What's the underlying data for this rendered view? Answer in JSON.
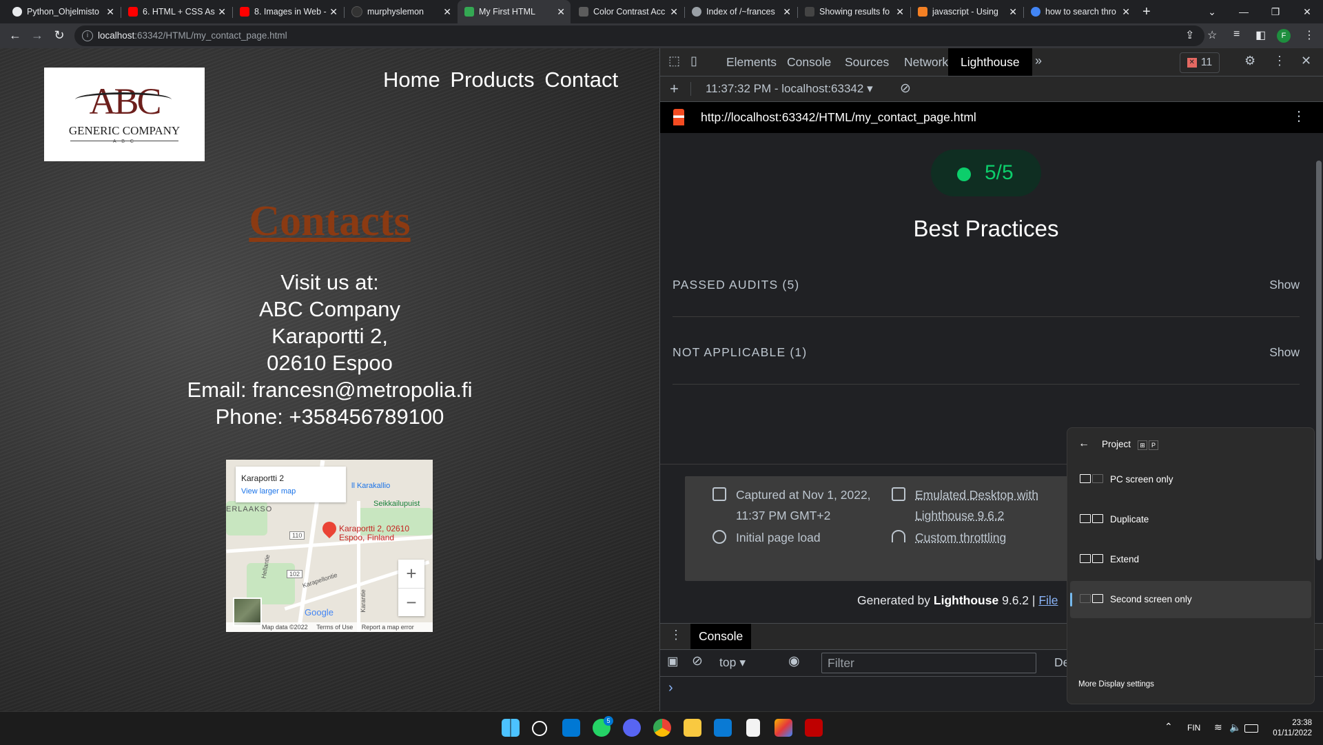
{
  "browser": {
    "tabs": [
      {
        "title": "Python_Ohjelmisto",
        "color": "#e8eaed"
      },
      {
        "title": "6. HTML + CSS Ass",
        "color": "#ff0000"
      },
      {
        "title": "8. Images in Web -",
        "color": "#ff0000"
      },
      {
        "title": "murphyslemon",
        "color": "#333333"
      },
      {
        "title": "My First HTML",
        "color": "#34a853"
      },
      {
        "title": "Color Contrast Acc",
        "color": "#5c5c5c"
      },
      {
        "title": "Index of /~frances",
        "color": "#9aa0a6"
      },
      {
        "title": "Showing results fo",
        "color": "#444444"
      },
      {
        "title": "javascript - Using",
        "color": "#f48024"
      },
      {
        "title": "how to search thro",
        "color": "#4285f4"
      }
    ],
    "url_host": "localhost",
    "url_rest": ":63342/HTML/my_contact_page.html",
    "profile_initial": "F"
  },
  "page": {
    "logo": {
      "abc": "ABC",
      "company": "GENERIC COMPANY",
      "small": "A B C"
    },
    "nav": [
      "Home",
      "Products",
      "Contact"
    ],
    "heading": "Contacts",
    "address": [
      "Visit us at:",
      "ABC Company",
      "Karaportti 2,",
      "02610 Espoo",
      "Email: francesn@metropolia.fi",
      "Phone: +358456789100"
    ],
    "map": {
      "place": "Karaportti 2",
      "view_larger": "View larger map",
      "pin_label_1": "Karaportti 2, 02610",
      "pin_label_2": "Espoo, Finland",
      "labels": [
        "ll Karakallio",
        "Seikkailupuist",
        "ERLAAKSO",
        "110",
        "102",
        "Karapellontie",
        "Hellantie",
        "Karantie"
      ],
      "footer": [
        "Map data ©2022",
        "Terms of Use",
        "Report a map error"
      ],
      "google": "Google"
    }
  },
  "devtools": {
    "tabs": [
      "Elements",
      "Console",
      "Sources",
      "Network",
      "Lighthouse"
    ],
    "active_tab": "Lighthouse",
    "error_count": "11",
    "report_select": "11:37:32 PM - localhost:63342",
    "report_url": "http://localhost:63342/HTML/my_contact_page.html",
    "score": "5/5",
    "category": "Best Practices",
    "groups": [
      {
        "label": "PASSED AUDITS (5)",
        "action": "Show"
      },
      {
        "label": "NOT APPLICABLE (1)",
        "action": "Show"
      }
    ],
    "captured_1": "Captured at Nov 1, 2022,",
    "captured_2": "11:37 PM GMT+2",
    "initial_load": "Initial page load",
    "emulated_1": "Emulated Desktop with",
    "emulated_2": "Lighthouse 9.6.2",
    "throttling": "Custom throttling",
    "generated_prefix": "Generated by",
    "generated_tool": "Lighthouse",
    "generated_version": "9.6.2 |",
    "generated_link": "File",
    "drawer_tab": "Console",
    "context": "top",
    "filter_placeholder": "Filter",
    "levels": "Defa",
    "prompt": "›"
  },
  "project": {
    "title": "Project",
    "key_hint": "P",
    "options": [
      "PC screen only",
      "Duplicate",
      "Extend",
      "Second screen only"
    ],
    "selected": "Second screen only",
    "more": "More Display settings"
  },
  "taskbar": {
    "whatsapp_badge": "5",
    "lang": "FIN",
    "time": "23:38",
    "date": "01/11/2022"
  }
}
